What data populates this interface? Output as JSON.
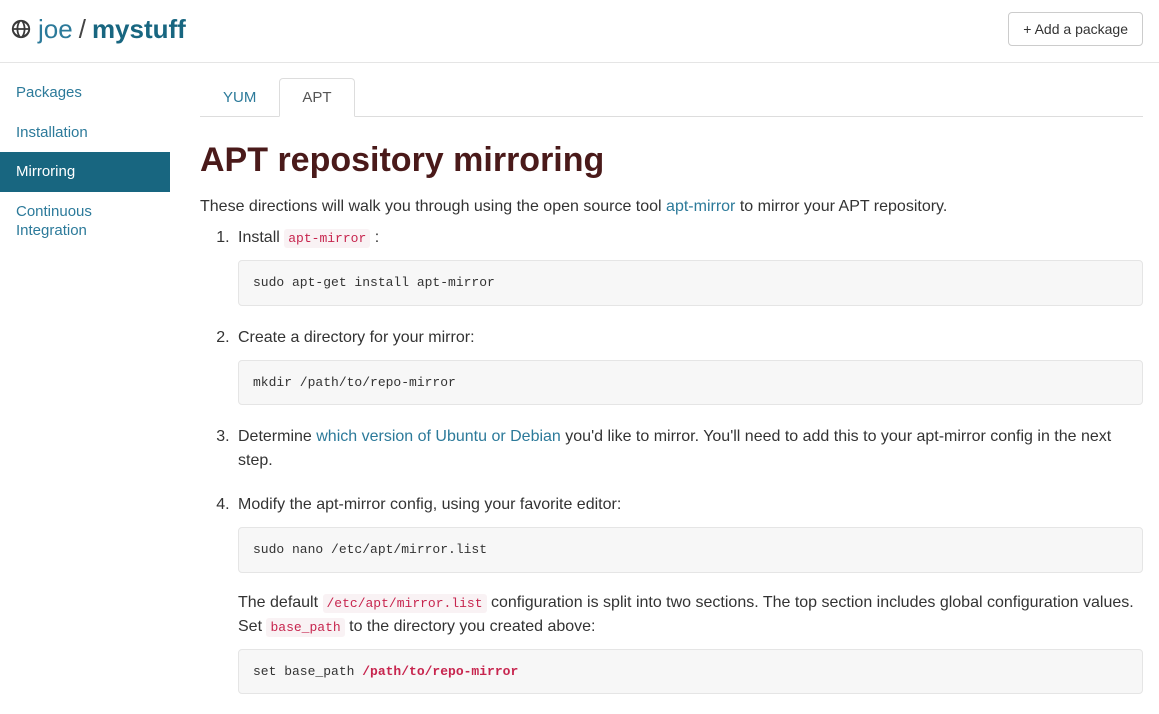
{
  "header": {
    "owner": "joe",
    "slash": "/",
    "repo": "mystuff",
    "add_package": "+ Add a package"
  },
  "sidebar": {
    "items": [
      {
        "label": "Packages",
        "active": false
      },
      {
        "label": "Installation",
        "active": false
      },
      {
        "label": "Mirroring",
        "active": true
      },
      {
        "label": "Continuous Integration",
        "active": false
      }
    ]
  },
  "tabs": [
    {
      "label": "YUM",
      "active": false
    },
    {
      "label": "APT",
      "active": true
    }
  ],
  "title": "APT repository mirroring",
  "intro_pre": "These directions will walk you through using the open source tool ",
  "intro_link": "apt-mirror",
  "intro_post": " to mirror your APT repository.",
  "steps": {
    "s1_text_pre": "Install ",
    "s1_code": "apt-mirror",
    "s1_text_post": " :",
    "s1_block": "sudo apt-get install apt-mirror",
    "s2_text": "Create a directory for your mirror:",
    "s2_block": "mkdir /path/to/repo-mirror",
    "s3_pre": "Determine ",
    "s3_link": "which version of Ubuntu or Debian",
    "s3_post": " you'd like to mirror. You'll need to add this to your apt-mirror config in the next step.",
    "s4_text": "Modify the apt-mirror config, using your favorite editor:",
    "s4_block": "sudo nano /etc/apt/mirror.list",
    "s4_para_a": "The default ",
    "s4_code_a": "/etc/apt/mirror.list",
    "s4_para_b": " configuration is split into two sections. The top section includes global configuration values. Set ",
    "s4_code_b": "base_path",
    "s4_para_c": " to the directory you created above:",
    "s4_block2_pre": "set base_path ",
    "s4_block2_hl": "/path/to/repo-mirror"
  }
}
